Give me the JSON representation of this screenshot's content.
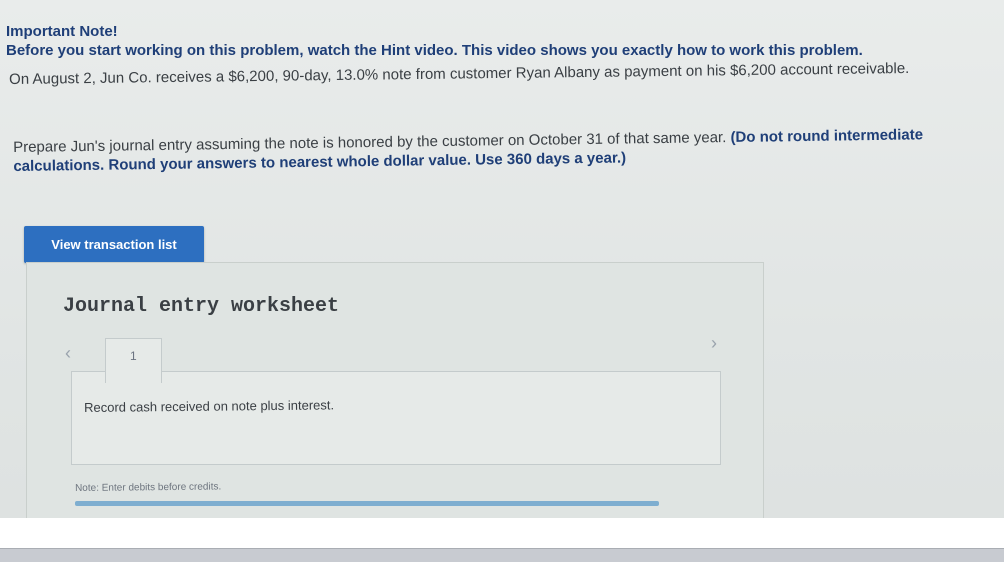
{
  "note": {
    "heading": "Important Note!",
    "body": "Before you start working on this problem, watch the Hint video. This video shows you exactly how to work this problem."
  },
  "problem": {
    "text": "On August 2, Jun Co. receives a $6,200, 90-day, 13.0% note from customer Ryan Albany as payment on his $6,200 account receivable."
  },
  "instruction": {
    "text": "Prepare Jun's journal entry assuming the note is honored by the customer on October 31 of that same year.",
    "bold": "(Do not round intermediate calculations. Round your answers to nearest whole dollar value. Use 360 days a year.)"
  },
  "button": {
    "view_transaction_list": "View transaction list"
  },
  "worksheet": {
    "title": "Journal entry worksheet",
    "prev_icon": "chevron-left-icon",
    "next_icon": "chevron-right-icon",
    "tabs": [
      "1"
    ],
    "entry_description": "Record cash received on note plus interest.",
    "note": "Note: Enter debits before credits."
  },
  "colors": {
    "heading_blue": "#1f3f78",
    "button_blue": "#2d6fc0"
  }
}
